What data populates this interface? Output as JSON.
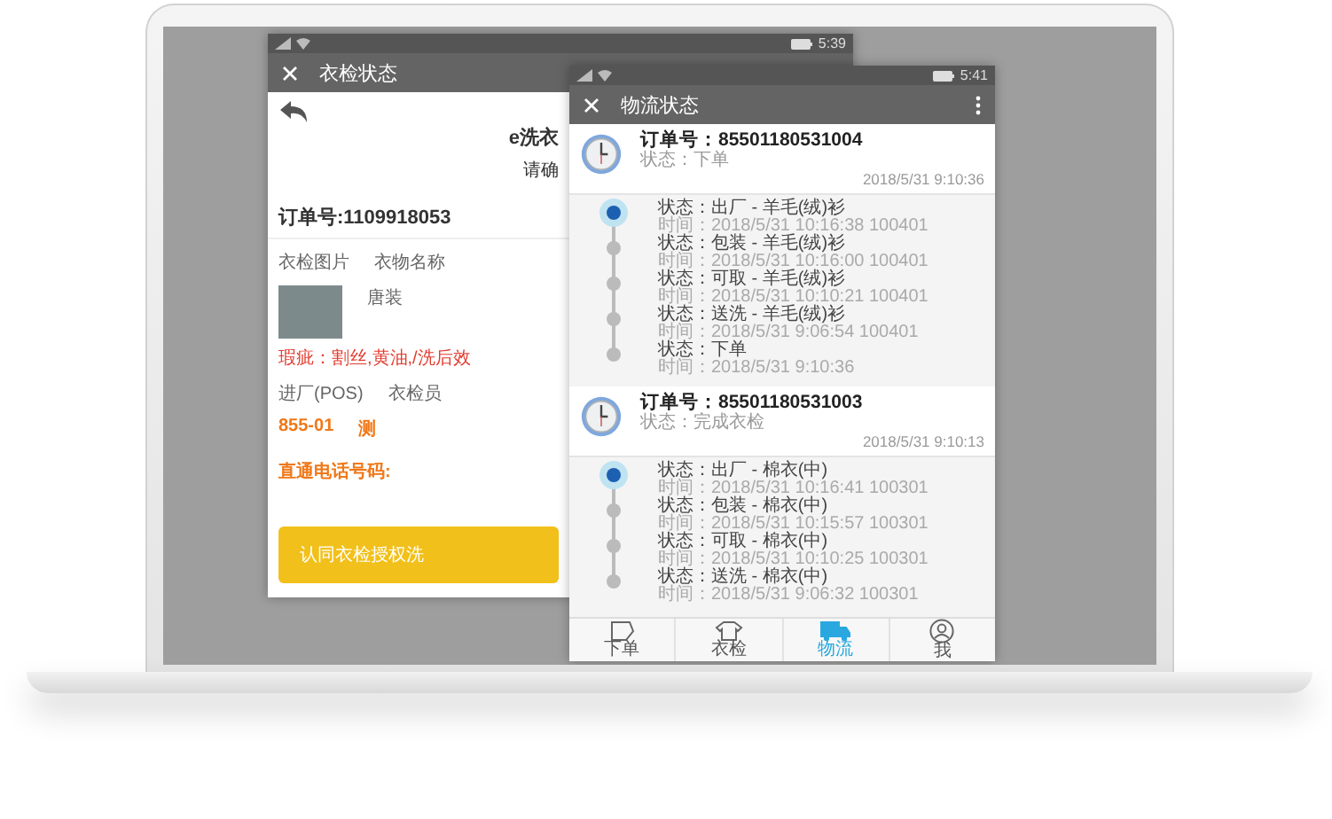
{
  "back_window": {
    "status_time": "5:39",
    "title": "衣检状态",
    "brand": "e洗衣",
    "prompt": "请确",
    "order_no": "订单号:1109918053",
    "photo_label": "衣检图片",
    "name_label": "衣物名称",
    "garment": "唐装",
    "defects": "瑕疵：割丝,黄油,/洗后效",
    "pos_label": "进厂(POS)",
    "inspector_label": "衣检员",
    "pos_value": "855-01",
    "inspector_value": "测",
    "hotline": "直通电话号码:",
    "confirm_button": "认同衣检授权洗"
  },
  "front_window": {
    "status_time": "5:41",
    "title": "物流状态",
    "orders": [
      {
        "order_no": "订单号：85501180531004",
        "status": "状态：下单",
        "time": "2018/5/31 9:10:36",
        "events": [
          {
            "status": "状态：出厂 - 羊毛(绒)衫",
            "time": "时间：2018/5/31 10:16:38 100401",
            "current": true
          },
          {
            "status": "状态：包装 - 羊毛(绒)衫",
            "time": "时间：2018/5/31 10:16:00 100401",
            "current": false
          },
          {
            "status": "状态：可取 - 羊毛(绒)衫",
            "time": "时间：2018/5/31 10:10:21 100401",
            "current": false
          },
          {
            "status": "状态：送洗 - 羊毛(绒)衫",
            "time": "时间：2018/5/31 9:06:54 100401",
            "current": false
          },
          {
            "status": "状态：下单",
            "time": "时间：2018/5/31 9:10:36",
            "current": false
          }
        ]
      },
      {
        "order_no": "订单号：85501180531003",
        "status": "状态：完成衣检",
        "time": "2018/5/31 9:10:13",
        "events": [
          {
            "status": "状态：出厂 - 棉衣(中)",
            "time": "时间：2018/5/31 10:16:41 100301",
            "current": true
          },
          {
            "status": "状态：包装 - 棉衣(中)",
            "time": "时间：2018/5/31 10:15:57 100301",
            "current": false
          },
          {
            "status": "状态：可取 - 棉衣(中)",
            "time": "时间：2018/5/31 10:10:25 100301",
            "current": false
          },
          {
            "status": "状态：送洗 - 棉衣(中)",
            "time": "时间：2018/5/31 9:06:32 100301",
            "current": false
          }
        ]
      }
    ],
    "tabs": [
      {
        "label": "下单",
        "selected": false
      },
      {
        "label": "衣检",
        "selected": false
      },
      {
        "label": "物流",
        "selected": true
      },
      {
        "label": "我",
        "selected": false
      }
    ]
  }
}
